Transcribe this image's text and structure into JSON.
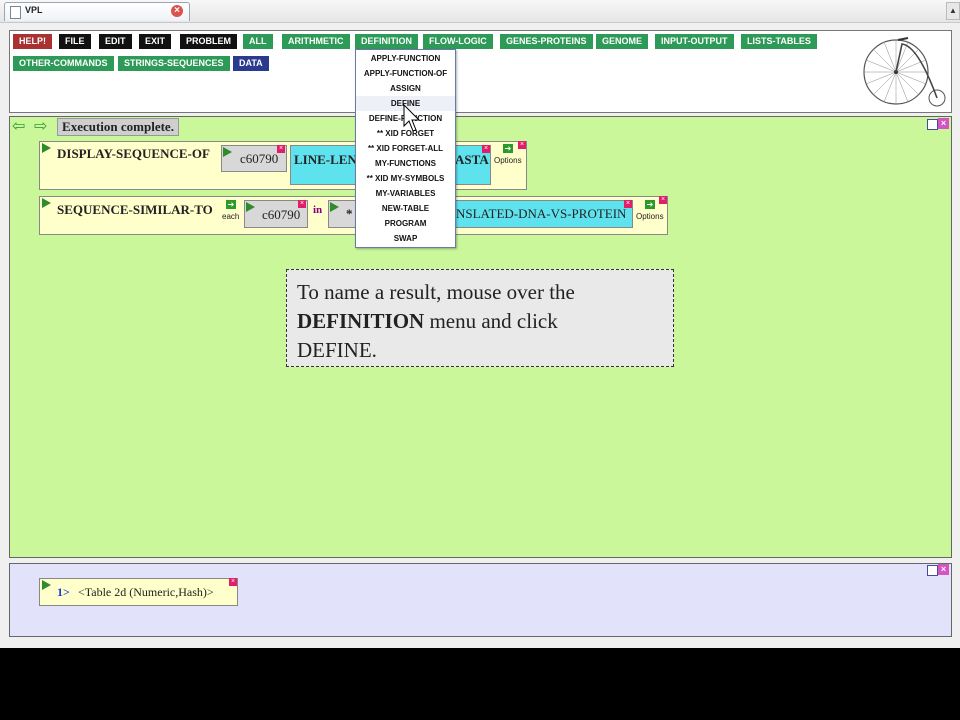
{
  "browser": {
    "tab_title": "VPL",
    "close_glyph": "×",
    "scroll_glyph": "▲"
  },
  "menubar": {
    "buttons": [
      {
        "label": "HELP!",
        "color": "#a83232"
      },
      {
        "label": "FILE",
        "color": "#111111"
      },
      {
        "label": "EDIT",
        "color": "#111111"
      },
      {
        "label": "EXIT",
        "color": "#111111"
      },
      {
        "label": "PROBLEM",
        "color": "#111111"
      },
      {
        "label": "ALL",
        "color": "#2e9a58"
      },
      {
        "label": "ARITHMETIC",
        "color": "#2e9a58"
      },
      {
        "label": "DEFINITION",
        "color": "#2e9a58"
      },
      {
        "label": "FLOW-LOGIC",
        "color": "#2e9a58"
      },
      {
        "label": "GENES-PROTEINS",
        "color": "#2e9a58"
      },
      {
        "label": "GENOME",
        "color": "#2e9a58"
      },
      {
        "label": "INPUT-OUTPUT",
        "color": "#2e9a58"
      },
      {
        "label": "LISTS-TABLES",
        "color": "#2e9a58"
      },
      {
        "label": "OTHER-COMMANDS",
        "color": "#2e9a58"
      },
      {
        "label": "STRINGS-SEQUENCES",
        "color": "#2e9a58"
      },
      {
        "label": "DATA",
        "color": "#2a3a8c"
      }
    ],
    "logo_icon": "penny-farthing-bicycle-icon"
  },
  "definition_menu": {
    "items": [
      "APPLY-FUNCTION",
      "APPLY-FUNCTION-OF",
      "ASSIGN",
      "DEFINE",
      "DEFINE-FUNCTION",
      "** XID FORGET",
      "** XID FORGET-ALL",
      "MY-FUNCTIONS",
      "** XID MY-SYMBOLS",
      "MY-VARIABLES",
      "NEW-TABLE",
      "PROGRAM",
      "SWAP"
    ],
    "highlighted": "DEFINE"
  },
  "workspace": {
    "back_glyph": "⇦",
    "forward_glyph": "⇨",
    "status": "Execution complete.",
    "minimize_glyph": "",
    "close_glyph": "×",
    "blocks": [
      {
        "name": "DISPLAY-SEQUENCE-OF",
        "arg1": "c60790",
        "arg2": "LINE-LEN",
        "arg2_tail": "ASTA",
        "options_label": "Options"
      },
      {
        "name": "SEQUENCE-SIMILAR-TO",
        "each_label": "each",
        "arg1": "c60790",
        "in_label": "in",
        "arg2_prefix": "*",
        "arg2_tail": "NSLATED-DNA-VS-PROTEIN",
        "options_label": "Options"
      }
    ]
  },
  "tooltip": {
    "line1": "To name a result, mouse over the",
    "bold": "DEFINITION",
    "line2_rest": " menu and click",
    "line3": "DEFINE."
  },
  "results": {
    "index": "1>",
    "value": "<Table 2d (Numeric,Hash)>",
    "close_glyph": "×"
  },
  "block_x_glyph": "×",
  "option_glyph": "➔"
}
